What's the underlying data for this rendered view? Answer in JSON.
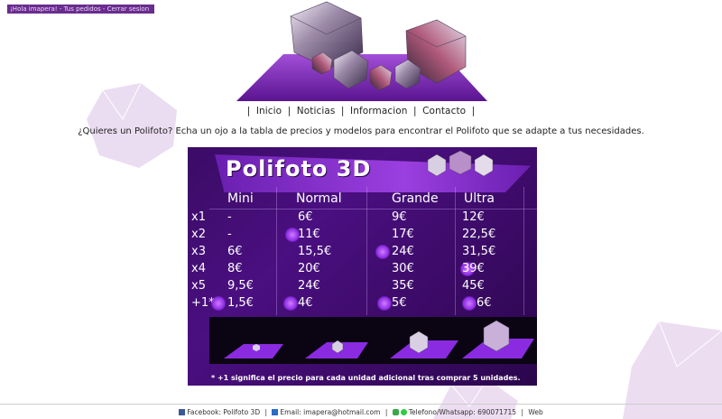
{
  "user_bar": {
    "greeting": "¡Hola imapera!",
    "orders": "Tus pedidos",
    "logout": "Cerrar sesion",
    "separator": "-"
  },
  "nav": {
    "sep": "|",
    "items": [
      "Inicio",
      "Noticias",
      "Informacion",
      "Contacto"
    ]
  },
  "intro": "¿Quieres un Polifoto? Echa un ojo a la tabla de precios y modelos para encontrar el Polifoto que se adapte a tus necesidades.",
  "price_table": {
    "title": "Polifoto 3D",
    "columns": [
      "Mini",
      "Normal",
      "Grande",
      "Ultra"
    ],
    "rows": [
      {
        "label": "x1",
        "values": [
          "-",
          "6€",
          "9€",
          "12€"
        ]
      },
      {
        "label": "x2",
        "values": [
          "-",
          "11€",
          "17€",
          "22,5€"
        ]
      },
      {
        "label": "x3",
        "values": [
          "6€",
          "15,5€",
          "24€",
          "31,5€"
        ]
      },
      {
        "label": "x4",
        "values": [
          "8€",
          "20€",
          "30€",
          "39€"
        ]
      },
      {
        "label": "x5",
        "values": [
          "9,5€",
          "24€",
          "35€",
          "45€"
        ]
      },
      {
        "label": "+1*",
        "values": [
          "1,5€",
          "4€",
          "5€",
          "6€"
        ]
      }
    ],
    "footnote": "* +1 significa el precio para cada unidad adicional tras comprar 5 unidades."
  },
  "footer": {
    "facebook": "Facebook: Polifoto 3D",
    "email": "Email: imapera@hotmail.com",
    "phone": "Telefono/Whatsapp: 690071715",
    "web": "Web",
    "sep": "|"
  },
  "colors": {
    "accent": "#6a2c8f",
    "card_bg": "#3b0c66",
    "band": "#9b3fe0"
  }
}
